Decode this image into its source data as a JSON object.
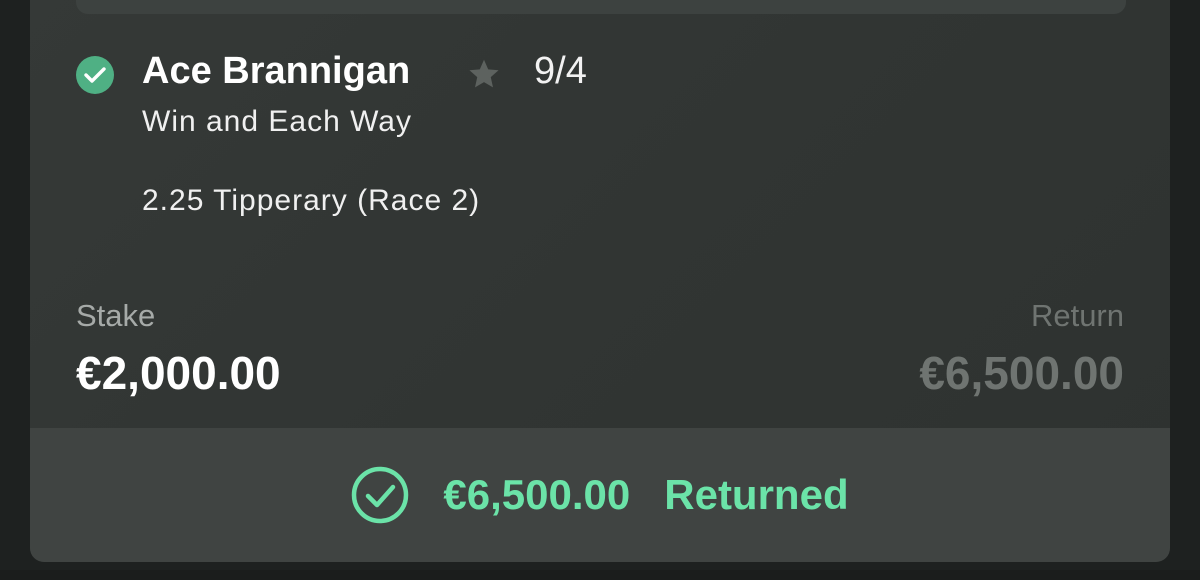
{
  "bet": {
    "selection": "Ace Brannigan",
    "odds": "9/4",
    "market": "Win and Each Way",
    "event": "2.25 Tipperary (Race 2)"
  },
  "stake": {
    "label": "Stake",
    "value": "€2,000.00"
  },
  "return": {
    "label": "Return",
    "value": "€6,500.00"
  },
  "result": {
    "amount": "€6,500.00",
    "label": "Returned"
  },
  "icons": {
    "status": "check-circle-icon",
    "favourite": "star-icon",
    "returned": "check-circle-outline-icon"
  },
  "colors": {
    "accent_green": "#6be3a8",
    "badge_green": "#4fb084",
    "muted_text": "#6f7471"
  }
}
